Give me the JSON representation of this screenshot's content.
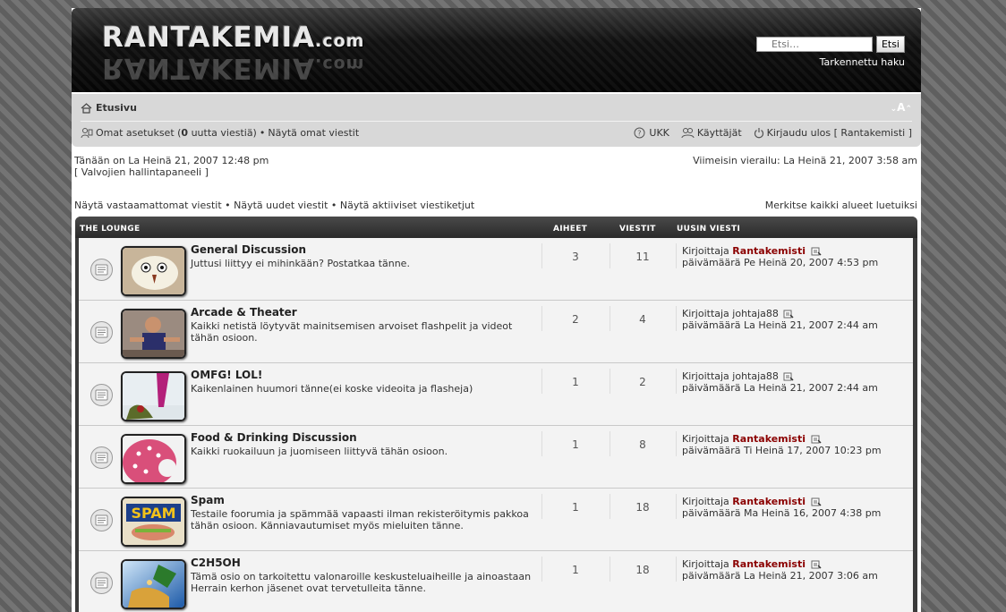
{
  "logo": {
    "main": "RANTAKEMIA",
    "suffix": ".com"
  },
  "search": {
    "placeholder": "Etsi…",
    "button": "Etsi",
    "advanced": "Tarkennettu haku"
  },
  "nav": {
    "home": "Etusivu",
    "font_size": "A",
    "user_prefix": "Omat asetukset (",
    "new_count": "0",
    "user_suffix": " uutta viestiä)",
    "bullet": " • ",
    "own_posts": "Näytä omat viestit",
    "faq": "UKK",
    "members": "Käyttäjät",
    "logout": "Kirjaudu ulos [ Rantakemisti ]"
  },
  "info": {
    "now": "Tänään on La Heinä 21, 2007 12:48 pm",
    "mcp": "[ Valvojien hallintapaneeli ]",
    "last_visit": "Viimeisin vierailu: La Heinä 21, 2007 3:58 am",
    "unanswered": "Näytä vastaamattomat viestit",
    "new_posts": "Näytä uudet viestit",
    "active": "Näytä aktiiviset viestiketjut",
    "bullet": " • ",
    "mark_read": "Merkitse kaikki alueet luetuiksi"
  },
  "table": {
    "category": "THE LOUNGE",
    "col_topics": "AIHEET",
    "col_posts": "VIESTIT",
    "col_last": "UUSIN VIESTI"
  },
  "forums": [
    {
      "title": "General Discussion",
      "desc": "Juttusi liittyy ei mihinkään? Postatkaa tänne.",
      "topics": "3",
      "posts": "11",
      "by": "Kirjoittaja ",
      "author": "Rantakemisti",
      "admin": true,
      "date": "päivämäärä Pe Heinä 20, 2007 4:53 pm"
    },
    {
      "title": "Arcade & Theater",
      "desc": "Kaikki netistä löytyvät mainitsemisen arvoiset flashpelit ja videot tähän osioon.",
      "topics": "2",
      "posts": "4",
      "by": "Kirjoittaja ",
      "author": "johtaja88",
      "admin": false,
      "date": "päivämäärä La Heinä 21, 2007 2:44 am"
    },
    {
      "title": "OMFG! LOL!",
      "desc": "Kaikenlainen huumori tänne(ei koske videoita ja flasheja)",
      "topics": "1",
      "posts": "2",
      "by": "Kirjoittaja ",
      "author": "johtaja88",
      "admin": false,
      "date": "päivämäärä La Heinä 21, 2007 2:44 am"
    },
    {
      "title": "Food & Drinking Discussion",
      "desc": "Kaikki ruokailuun ja juomiseen liittyvä tähän osioon.",
      "topics": "1",
      "posts": "8",
      "by": "Kirjoittaja ",
      "author": "Rantakemisti",
      "admin": true,
      "date": "päivämäärä Ti Heinä 17, 2007 10:23 pm"
    },
    {
      "title": "Spam",
      "desc": "Testaile foorumia ja spämmää vapaasti ilman rekisteröitymis pakkoa tähän osioon. Känniavautumiset myös mieluiten tänne.",
      "topics": "1",
      "posts": "18",
      "by": "Kirjoittaja ",
      "author": "Rantakemisti",
      "admin": true,
      "date": "päivämäärä Ma Heinä 16, 2007 4:38 pm",
      "thumb_text": "SPAM"
    },
    {
      "title": "C2H5OH",
      "desc": "Tämä osio on tarkoitettu valonaroille keskusteluaiheille ja ainoastaan Herrain kerhon jäsenet ovat tervetulleita tänne.",
      "topics": "1",
      "posts": "18",
      "by": "Kirjoittaja ",
      "author": "Rantakemisti",
      "admin": true,
      "date": "päivämäärä La Heinä 21, 2007 3:06 am"
    }
  ],
  "colors": {
    "admin": "#8b0000",
    "header": "#111111",
    "navbar": "#d8d8d8",
    "row": "#f3f3f3"
  }
}
